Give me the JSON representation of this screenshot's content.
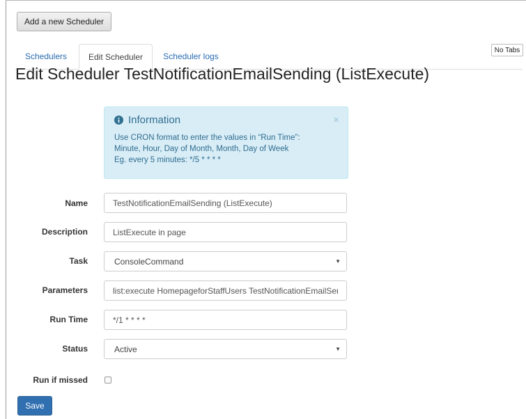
{
  "toolbar": {
    "add_label": "Add a new Scheduler"
  },
  "tabs": [
    {
      "label": "Schedulers",
      "active": false
    },
    {
      "label": "Edit Scheduler",
      "active": true
    },
    {
      "label": "Scheduler logs",
      "active": false
    }
  ],
  "no_tabs_label": "No Tabs",
  "page_title": "Edit Scheduler TestNotificationEmailSending (ListExecute)",
  "info": {
    "title": "Information",
    "lines": [
      "Use CRON format to enter the values in “Run Time”:",
      "Minute, Hour, Day of Month, Month, Day of Week",
      "Eg. every 5 minutes: */5 * * * *"
    ],
    "close": "×"
  },
  "form": {
    "name": {
      "label": "Name",
      "value": "TestNotificationEmailSending (ListExecute)"
    },
    "description": {
      "label": "Description",
      "value": "ListExecute in page"
    },
    "task": {
      "label": "Task",
      "value": "ConsoleCommand"
    },
    "parameters": {
      "label": "Parameters",
      "value": "list:execute HomepageforStaffUsers TestNotificationEmailSending"
    },
    "run_time": {
      "label": "Run Time",
      "value": "*/1 * * * *"
    },
    "status": {
      "label": "Status",
      "value": "Active"
    },
    "run_if_missed": {
      "label": "Run if missed",
      "checked": false
    }
  },
  "save_label": "Save",
  "colors": {
    "primary": "#3070b0",
    "link": "#2a6cb0",
    "info_bg": "#d9edf7",
    "info_text": "#31708f"
  }
}
